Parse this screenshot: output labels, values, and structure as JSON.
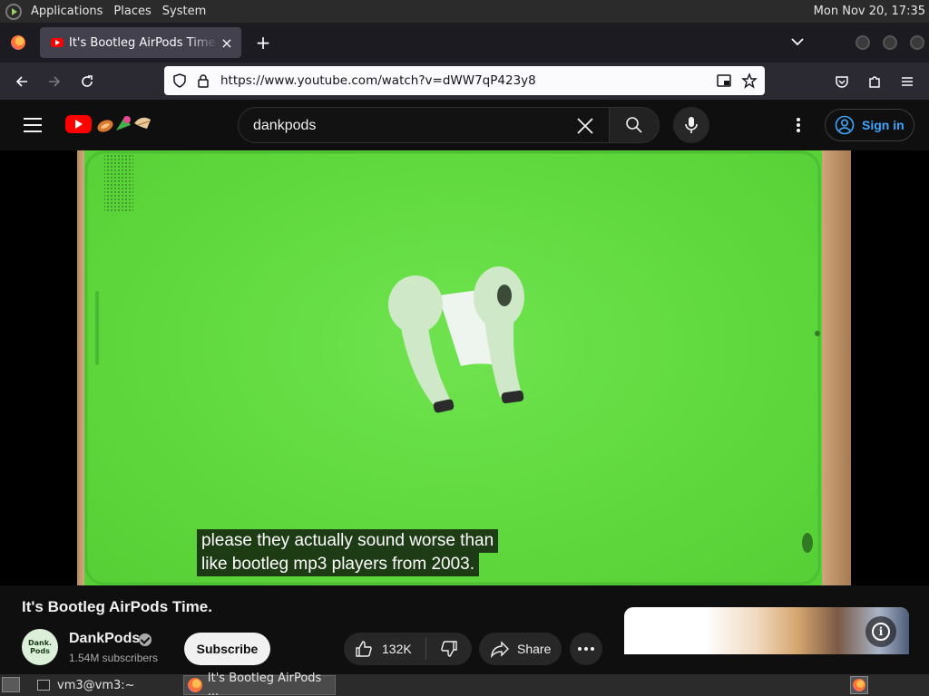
{
  "desktop": {
    "menus": [
      "Applications",
      "Places",
      "System"
    ],
    "clock": "Mon Nov 20, 17:35"
  },
  "browser": {
    "tab": {
      "title": "It's Bootleg AirPods Time. – YouTube",
      "close": "×"
    },
    "new_tab": "+",
    "url": "https://www.youtube.com/watch?v=dWW7qP423y8"
  },
  "youtube": {
    "search": {
      "value": "dankpods"
    },
    "sign_in": "Sign in"
  },
  "video": {
    "caption_lines": [
      "please they actually sound worse than",
      "like bootleg mp3 players from 2003."
    ],
    "title": "It's Bootleg AirPods Time.",
    "channel": {
      "name": "DankPods",
      "subscribers": "1.54M subscribers",
      "avatar_text": "Dank. Pods"
    },
    "subscribe": "Subscribe",
    "likes": "132K",
    "share": "Share"
  },
  "taskbar": {
    "items": [
      {
        "label": "vm3@vm3:~",
        "icon": "terminal-icon"
      },
      {
        "label": "It's Bootleg AirPods ...",
        "icon": "firefox-icon"
      }
    ]
  },
  "colors": {
    "youtube_red": "#ff0000",
    "link_blue": "#3ea6ff",
    "background": "#0f0f0f",
    "green_screen": "#62db40"
  }
}
